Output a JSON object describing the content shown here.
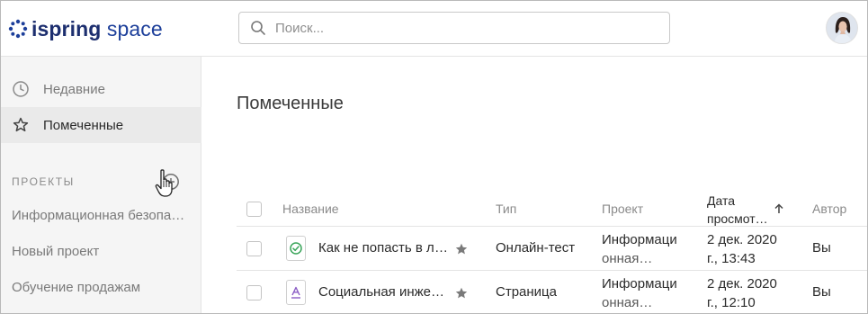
{
  "header": {
    "logo_text_1": "ispring",
    "logo_text_2": "space",
    "search_placeholder": "Поиск..."
  },
  "sidebar": {
    "recent_label": "Недавние",
    "starred_label": "Помеченные",
    "projects_title": "ПРОЕКТЫ",
    "projects": [
      "Информационная безопасность",
      "Новый проект",
      "Обучение продажам"
    ]
  },
  "main": {
    "title": "Помеченные",
    "table": {
      "headers": {
        "name": "Название",
        "type": "Тип",
        "project": "Проект",
        "date_line1": "Дата",
        "date_line2": "просмот…",
        "author": "Автор"
      },
      "rows": [
        {
          "name": "Как не попасть в ловушку мошенников",
          "type": "Онлайн-тест",
          "project_line1": "Информаци",
          "project_line2": "онная…",
          "date_line1": "2 дек. 2020",
          "date_line2": "г., 13:43",
          "author": "Вы",
          "icon": "test-icon"
        },
        {
          "name": "Социальная инженерия",
          "type": "Страница",
          "project_line1": "Информаци",
          "project_line2": "онная…",
          "date_line1": "2 дек. 2020",
          "date_line2": "г., 12:10",
          "author": "Вы",
          "icon": "page-icon"
        }
      ]
    }
  },
  "colors": {
    "brand_dark": "#1d2f6f",
    "brand_blue": "#1d3f9a",
    "test_green": "#3aa55a",
    "page_purple": "#8a5cc4",
    "star_gray": "#7a7a7a"
  }
}
